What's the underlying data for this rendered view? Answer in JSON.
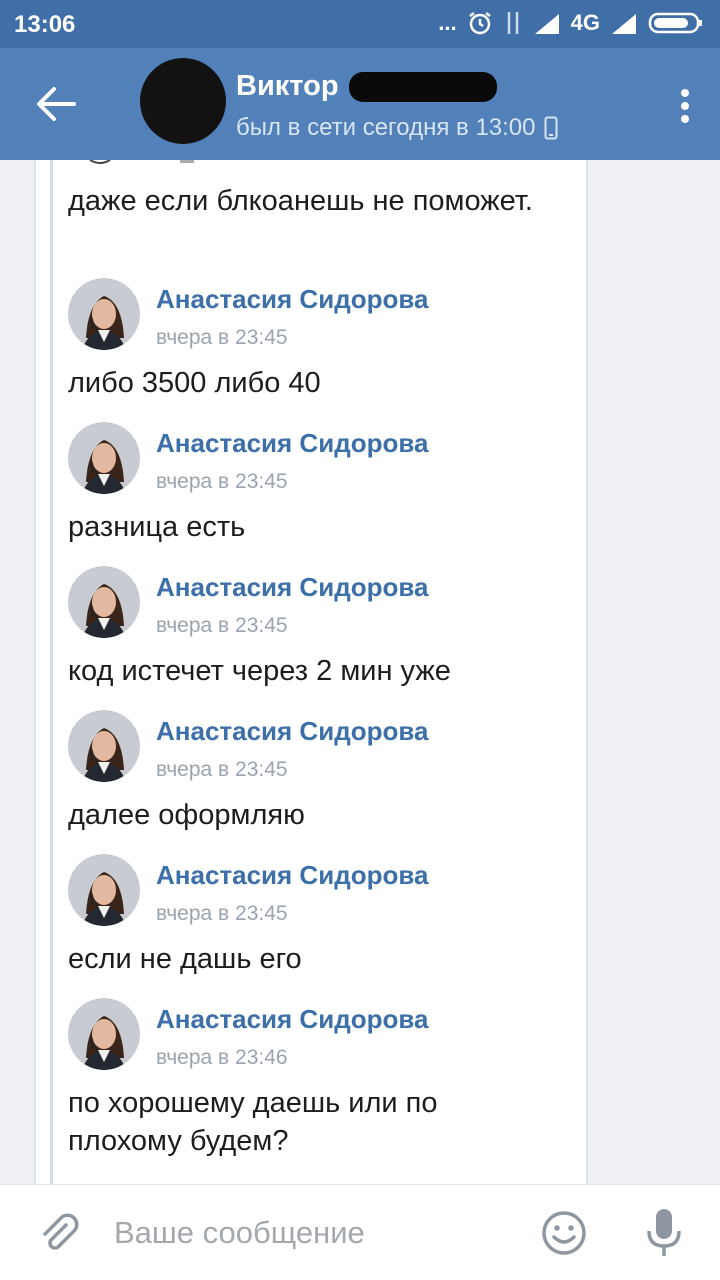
{
  "statusbar": {
    "time": "13:06",
    "dots": "...",
    "network": "4G",
    "battery_level": 0.85
  },
  "header": {
    "name": "Виктор",
    "status": "был в сети сегодня в 13:00"
  },
  "messages": [
    {
      "type": "text",
      "text": "даже если блкоанешь не поможет."
    },
    {
      "type": "head",
      "sender": "Анастасия Сидорова",
      "time": "вчера в 23:45"
    },
    {
      "type": "text",
      "text": "либо 3500 либо 40"
    },
    {
      "type": "head",
      "sender": "Анастасия Сидорова",
      "time": "вчера в 23:45"
    },
    {
      "type": "text",
      "text": "разница есть"
    },
    {
      "type": "head",
      "sender": "Анастасия Сидорова",
      "time": "вчера в 23:45"
    },
    {
      "type": "text",
      "text": "код истечет через 2 мин уже"
    },
    {
      "type": "head",
      "sender": "Анастасия Сидорова",
      "time": "вчера в 23:45"
    },
    {
      "type": "text",
      "text": "далее оформляю"
    },
    {
      "type": "head",
      "sender": "Анастасия Сидорова",
      "time": "вчера в 23:45"
    },
    {
      "type": "text",
      "text": "если не дашь его"
    },
    {
      "type": "head",
      "sender": "Анастасия Сидорова",
      "time": "вчера в 23:46"
    },
    {
      "type": "text",
      "text": "по хорошему даешь или по плохому будем?"
    }
  ],
  "composer": {
    "placeholder": "Ваше сообщение"
  },
  "colors": {
    "toolbar": "#5181b8",
    "statusbar": "#3f6fa6",
    "sender": "#3d6fa8"
  }
}
